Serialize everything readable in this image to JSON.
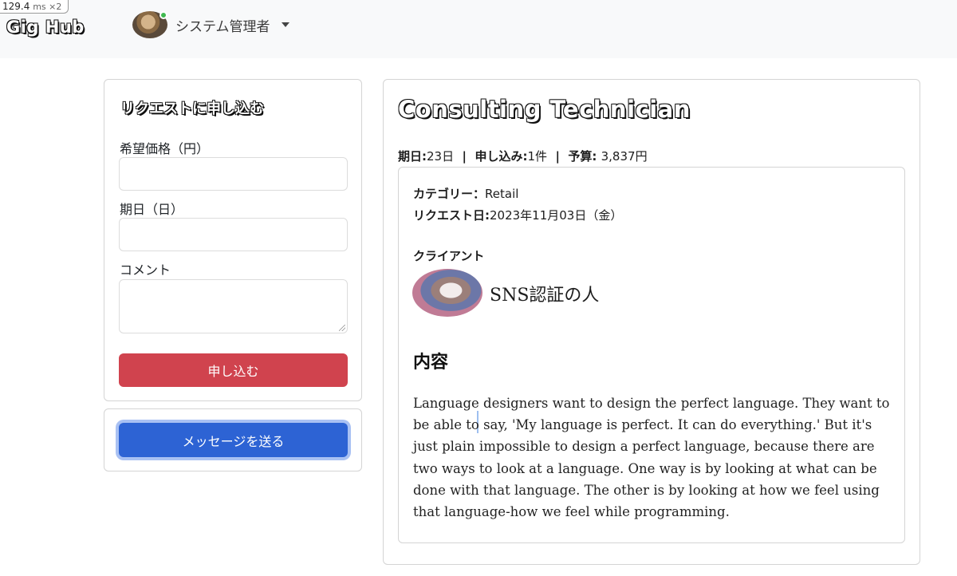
{
  "perf": {
    "value": "129.4",
    "unit": "ms ×2"
  },
  "header": {
    "brand": "Gig Hub",
    "user_name": "システム管理者"
  },
  "apply": {
    "title": "リクエストに申し込む",
    "price_label": "希望価格（円）",
    "price_value": "",
    "days_label": "期日（日）",
    "days_value": "",
    "comment_label": "コメント",
    "comment_value": "",
    "submit_label": "申し込む"
  },
  "message": {
    "button_label": "メッセージを送る"
  },
  "job": {
    "title": "Consulting Technician",
    "deadline_label": "期日:",
    "deadline_value": "23日",
    "applications_label": "申し込み:",
    "applications_value": "1件",
    "budget_label": "予算: ",
    "budget_value": "3,837円",
    "category_label": "カテゴリー：",
    "category_value": "Retail",
    "request_date_label": "リクエスト日:",
    "request_date_value": "2023年11月03日（金）",
    "client_heading": "クライアント",
    "client_name": "SNS認証の人",
    "content_heading": "内容",
    "content": "Language designers want to design the perfect language. They want to be able to say, 'My language is perfect. It can do everything.' But it's just plain impossible to design a perfect language, because there are two ways to look at a language. One way is by looking at what can be done with that language. The other is by looking at how we feel using that language-how we feel while programming."
  }
}
